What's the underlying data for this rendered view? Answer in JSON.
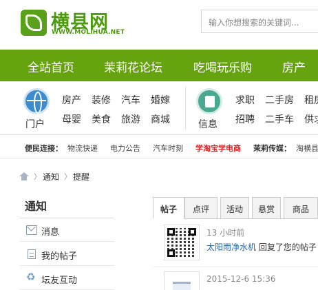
{
  "header": {
    "logo_title": "横县网",
    "logo_url": "WWW.MOLIHUA.NET",
    "search_placeholder": "输入你想搜索的关键词..."
  },
  "nav": {
    "items": [
      "全站首页",
      "茉莉花论坛",
      "吃喝玩乐购",
      "房产"
    ]
  },
  "categories": {
    "portal_label": "门户",
    "portal_links_row1": [
      "房产",
      "装修",
      "汽车",
      "婚嫁"
    ],
    "portal_links_row2": [
      "母婴",
      "美食",
      "旅游",
      "商城"
    ],
    "info_label": "信息",
    "info_links_row1": [
      "求职",
      "二手房",
      "租房"
    ],
    "info_links_row2": [
      "招聘",
      "二手车",
      "供求"
    ]
  },
  "convenience": {
    "label1": "便民连接：",
    "links": [
      "物流快递",
      "电力公告",
      "汽车时刻"
    ],
    "highlight": "学淘宝学电商",
    "label2": "茉莉传媒：",
    "link_last": "淘横县"
  },
  "breadcrumb": {
    "items": [
      "通知",
      "提醒"
    ]
  },
  "sidebar": {
    "title": "通知",
    "items": [
      {
        "label": "消息",
        "icon": "mail-icon"
      },
      {
        "label": "我的帖子",
        "icon": "document-icon"
      },
      {
        "label": "坛友互动",
        "icon": "recycle-icon"
      }
    ]
  },
  "tabs": [
    "帖子",
    "点评",
    "活动",
    "悬赏",
    "商品"
  ],
  "notices": [
    {
      "time": "13 小时前",
      "user": "太阳雨净水机",
      "action": "回复了您的帖子"
    },
    {
      "time": "2015-12-6 15:36"
    }
  ],
  "colors": {
    "brand_green": "#65a30f",
    "logo_green": "#4c9a0d",
    "highlight_red": "#e02020",
    "link_blue": "#2266aa"
  }
}
